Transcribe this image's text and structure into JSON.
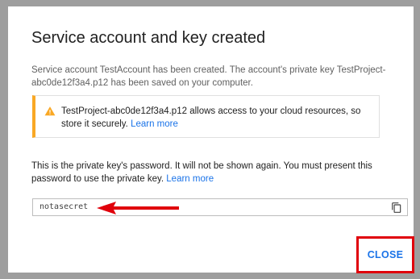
{
  "dialog": {
    "title": "Service account and key created",
    "description": "Service account TestAccount has been created. The account's private key TestProject-abc0de12f3a4.p12 has been saved on your computer.",
    "warning": {
      "icon": "warning-triangle-icon",
      "text": "TestProject-abc0de12f3a4.p12 allows access to your cloud resources, so store it securely.",
      "link": "Learn more"
    },
    "password_info": {
      "text": "This is the private key's password. It will not be shown again. You must present this password to use the private key.",
      "link": "Learn more"
    },
    "password_field": {
      "value": "notasecret",
      "copy_icon": "copy-icon"
    },
    "close_label": "CLOSE"
  },
  "colors": {
    "accent": "#1a73e8",
    "warning": "#f9a825",
    "annotation_red": "#e0000b"
  }
}
